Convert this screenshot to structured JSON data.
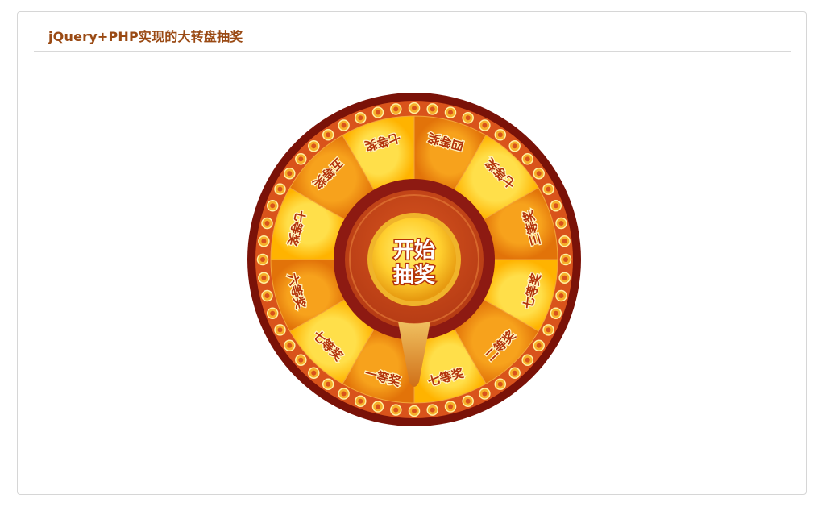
{
  "header": {
    "title": "jQuery+PHP实现的大转盘抽奖"
  },
  "wheel": {
    "prizes": [
      "四等奖",
      "七等奖",
      "三等奖",
      "七等奖",
      "二等奖",
      "七等奖",
      "一等奖",
      "七等奖",
      "六等奖",
      "七等奖",
      "五等奖",
      "七等奖"
    ],
    "start_line1": "开始",
    "start_line2": "抽奖",
    "colors": {
      "outer_ring": "#7a1208",
      "rim": "#d9531b",
      "bead": "#f6b02a",
      "segment_light": "#ffc107",
      "segment_dark": "#f08a07",
      "label": "#b3320a",
      "hub_ring": "#8d1a12",
      "hub_inner": "#c8461a",
      "button_gold": "#ffd94a"
    }
  }
}
